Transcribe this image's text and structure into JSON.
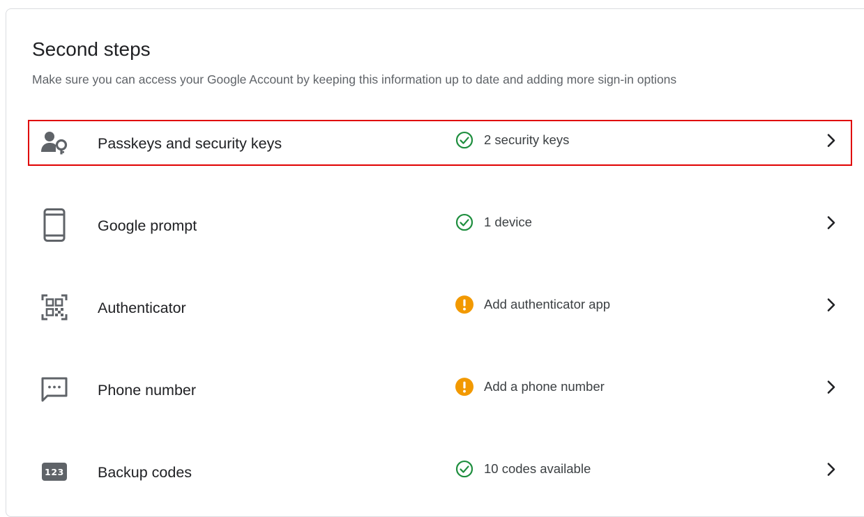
{
  "section": {
    "title": "Second steps",
    "subtitle": "Make sure you can access your Google Account by keeping this information up to date and adding more sign-in options"
  },
  "rows": [
    {
      "label": "Passkeys and security keys",
      "icon": "person-key-icon",
      "status": "2 security keys",
      "status_type": "ok",
      "highlighted": true
    },
    {
      "label": "Google prompt",
      "icon": "phone-device-icon",
      "status": "1 device",
      "status_type": "ok"
    },
    {
      "label": "Authenticator",
      "icon": "qr-code-icon",
      "status": "Add authenticator app",
      "status_type": "warning"
    },
    {
      "label": "Phone number",
      "icon": "message-icon",
      "status": "Add a phone number",
      "status_type": "warning"
    },
    {
      "label": "Backup codes",
      "icon": "backup-codes-icon",
      "icon_text": "123",
      "status": "10 codes available",
      "status_type": "ok"
    }
  ],
  "colors": {
    "ok": "#1e8e3e",
    "warning": "#f29900",
    "highlight_border": "#e00000",
    "icon_gray": "#5f6368"
  }
}
